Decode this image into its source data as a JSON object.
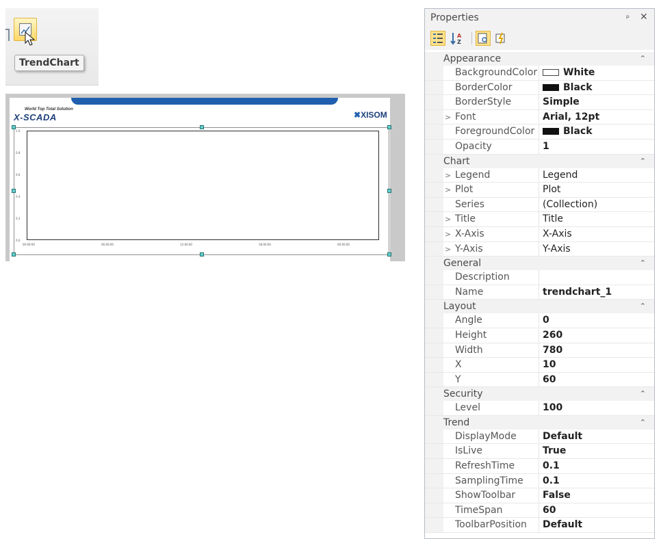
{
  "toolbar": {
    "tooltip": "TrendChart"
  },
  "canvas": {
    "logo_left_tag": "World Top Total Solution",
    "logo_left_main": "X-SCADA",
    "logo_right": "XISOM",
    "y_ticks": [
      "1.0",
      "0.8",
      "0.6",
      "0.4",
      "0.2",
      "0.0"
    ],
    "x_ticks": [
      "00:00:00",
      "06:00:00",
      "12:00:00",
      "18:00:00",
      "00:00:00"
    ]
  },
  "properties": {
    "title": "Properties",
    "categories": [
      {
        "name": "Appearance",
        "rows": [
          {
            "name": "BackgroundColor",
            "value": "White",
            "swatch": "white",
            "bold": true
          },
          {
            "name": "BorderColor",
            "value": "Black",
            "swatch": "black",
            "bold": true
          },
          {
            "name": "BorderStyle",
            "value": "Simple",
            "bold": true
          },
          {
            "name": "Font",
            "value": "Arial, 12pt",
            "bold": true,
            "expandable": true
          },
          {
            "name": "ForegroundColor",
            "value": "Black",
            "swatch": "black",
            "bold": true
          },
          {
            "name": "Opacity",
            "value": "1",
            "bold": true
          }
        ]
      },
      {
        "name": "Chart",
        "rows": [
          {
            "name": "Legend",
            "value": "Legend",
            "expandable": true
          },
          {
            "name": "Plot",
            "value": "Plot",
            "expandable": true
          },
          {
            "name": "Series",
            "value": "(Collection)"
          },
          {
            "name": "Title",
            "value": "Title",
            "expandable": true
          },
          {
            "name": "X-Axis",
            "value": "X-Axis",
            "expandable": true
          },
          {
            "name": "Y-Axis",
            "value": "Y-Axis",
            "expandable": true
          }
        ]
      },
      {
        "name": "General",
        "rows": [
          {
            "name": "Description",
            "value": ""
          },
          {
            "name": "Name",
            "value": "trendchart_1",
            "bold": true
          }
        ]
      },
      {
        "name": "Layout",
        "rows": [
          {
            "name": "Angle",
            "value": "0",
            "bold": true
          },
          {
            "name": "Height",
            "value": "260",
            "bold": true
          },
          {
            "name": "Width",
            "value": "780",
            "bold": true
          },
          {
            "name": "X",
            "value": "10",
            "bold": true
          },
          {
            "name": "Y",
            "value": "60",
            "bold": true
          }
        ]
      },
      {
        "name": "Security",
        "rows": [
          {
            "name": "Level",
            "value": "100",
            "bold": true
          }
        ]
      },
      {
        "name": "Trend",
        "rows": [
          {
            "name": "DisplayMode",
            "value": "Default",
            "bold": true
          },
          {
            "name": "IsLive",
            "value": "True",
            "bold": true
          },
          {
            "name": "RefreshTime",
            "value": "0.1",
            "bold": true
          },
          {
            "name": "SamplingTime",
            "value": "0.1",
            "bold": true
          },
          {
            "name": "ShowToolbar",
            "value": "False",
            "bold": true
          },
          {
            "name": "TimeSpan",
            "value": "60",
            "bold": true
          },
          {
            "name": "ToolbarPosition",
            "value": "Default",
            "bold": true
          }
        ]
      }
    ]
  }
}
